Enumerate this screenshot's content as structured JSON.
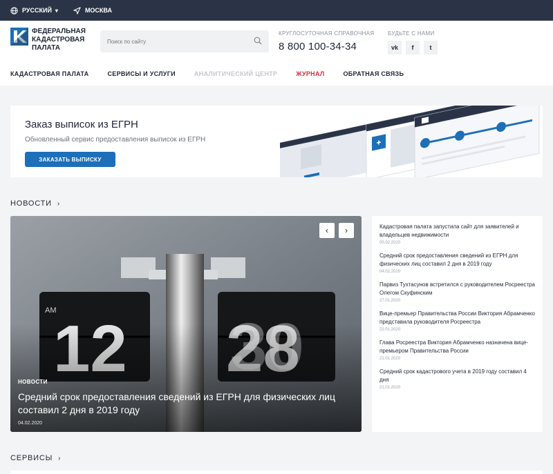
{
  "topbar": {
    "language": "РУССКИЙ",
    "location": "МОСКВА"
  },
  "header": {
    "logo_text": "Федеральная кадастровая палата",
    "search_placeholder": "Поиск по сайту",
    "hotline_label": "КРУГЛОСУТОЧНАЯ СПРАВОЧНАЯ",
    "phone": "8 800 100-34-34",
    "social_label": "БУДЬТЕ С НАМИ",
    "social": [
      "vk",
      "f",
      "t"
    ]
  },
  "nav": {
    "items": [
      {
        "label": "КАДАСТРОВАЯ ПАЛАТА"
      },
      {
        "label": "СЕРВИСЫ И УСЛУГИ"
      },
      {
        "label": "АНАЛИТИЧЕСКИЙ ЦЕНТР"
      },
      {
        "label": "ЖУРНАЛ"
      },
      {
        "label": "ОБРАТНАЯ СВЯЗЬ"
      }
    ]
  },
  "banner": {
    "title": "Заказ выписок из ЕГРН",
    "subtitle": "Обновленный сервис предоставления выписок из ЕГРН",
    "button": "ЗАКАЗАТЬ ВЫПИСКУ"
  },
  "news_section": {
    "title": "НОВОСТИ",
    "arrow": "›"
  },
  "featured": {
    "tag": "НОВОСТИ",
    "headline": "Средний срок предоставления сведений из ЕГРН для физических лиц составил 2 дня в 2019 году",
    "date": "04.02.2020",
    "prev": "‹",
    "next": "›",
    "clock_am": "AM"
  },
  "news": [
    {
      "title": "Кадастровая палата запустила сайт для заявителей и владельцев недвижимости",
      "date": "05.02.2020"
    },
    {
      "title": "Средний срок предоставления сведений из ЕГРН для физических лиц составил 2 дня в 2019 году",
      "date": "04.02.2020"
    },
    {
      "title": "Парвиз Тухтасунов встретился с руководителем Росреестра Олегом Скуфинским",
      "date": "27.01.2020"
    },
    {
      "title": "Вице-премьер Правительства России Виктория Абрамченко представила руководителя Росреестра",
      "date": "22.01.2020"
    },
    {
      "title": "Глава Росреестра Виктория Абрамченко назначена вице-премьером Правительства России",
      "date": "21.01.2020"
    },
    {
      "title": "Средний срок кадастрового учета в 2019 году составил 4 дня",
      "date": "21.01.2020"
    }
  ],
  "services_section": {
    "title": "СЕРВИСЫ",
    "arrow": "›"
  },
  "colors": {
    "topbar": "#2b3447",
    "accent_blue": "#1c6fb8",
    "journal_red": "#d62d3a"
  }
}
